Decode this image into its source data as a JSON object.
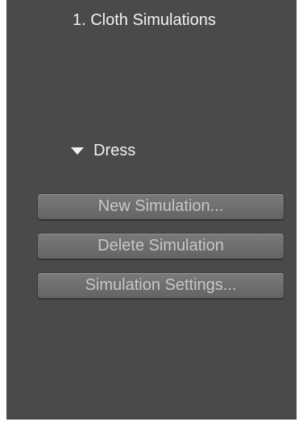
{
  "panel": {
    "title": "1. Cloth Simulations",
    "group": {
      "label": "Dress",
      "expanded": true,
      "toggle_icon": "triangle-down-icon"
    },
    "buttons": {
      "new_simulation": "New Simulation...",
      "delete_simulation": "Delete Simulation",
      "simulation_settings": "Simulation Settings..."
    }
  },
  "colors": {
    "panel_background": "#4a4a4a",
    "button_background": "#6e6e6e",
    "button_text": "#c7c7c7",
    "text": "#f2f2f2"
  }
}
